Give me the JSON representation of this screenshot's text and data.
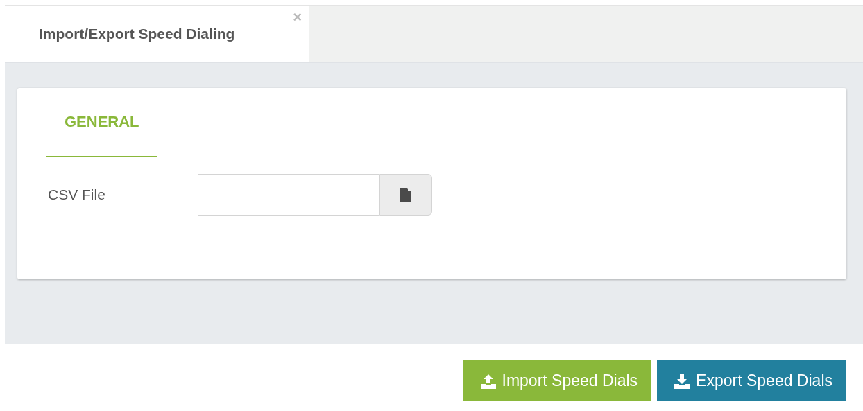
{
  "window_tab": {
    "title": "Import/Export Speed Dialing",
    "close": "×"
  },
  "form_tabs": [
    {
      "label": "GENERAL",
      "selected": true
    }
  ],
  "fields": [
    {
      "label": "CSV File"
    }
  ],
  "buttons": [
    {
      "kind": "import",
      "label": "Import Speed Dials"
    },
    {
      "kind": "export",
      "label": "Export Speed Dials"
    }
  ]
}
